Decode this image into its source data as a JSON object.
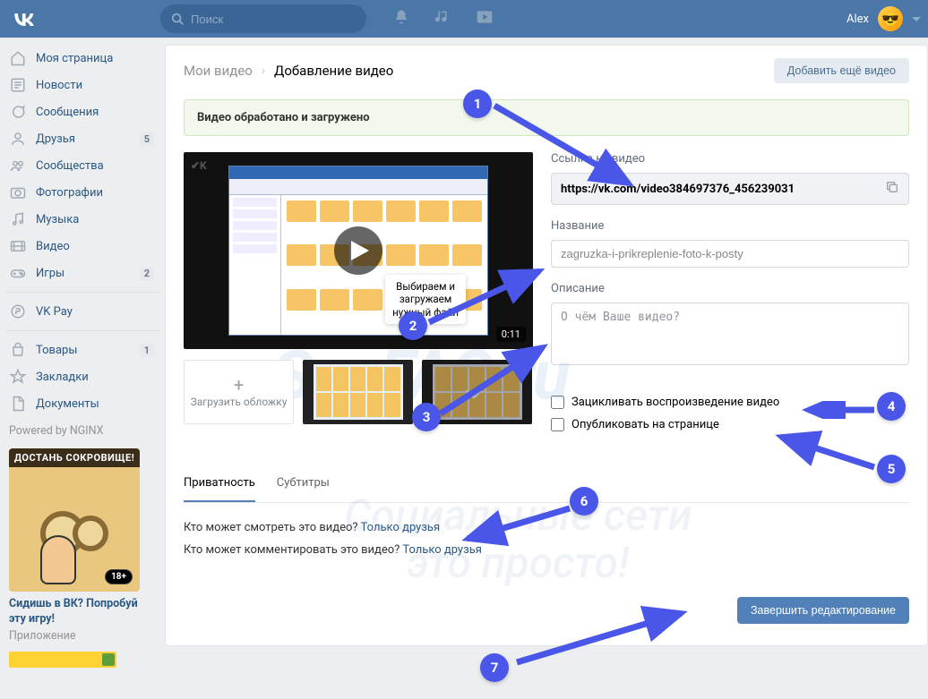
{
  "header": {
    "search_placeholder": "Поиск",
    "user_name": "Alex"
  },
  "sidebar": {
    "items": [
      {
        "label": "Моя страница"
      },
      {
        "label": "Новости"
      },
      {
        "label": "Сообщения"
      },
      {
        "label": "Друзья",
        "badge": "5"
      },
      {
        "label": "Сообщества"
      },
      {
        "label": "Фотографии"
      },
      {
        "label": "Музыка"
      },
      {
        "label": "Видео"
      },
      {
        "label": "Игры",
        "badge": "2"
      },
      {
        "label": "VK Pay"
      },
      {
        "label": "Товары",
        "badge": "1"
      },
      {
        "label": "Закладки"
      },
      {
        "label": "Документы"
      }
    ],
    "powered": "Powered by NGINX",
    "promo": {
      "banner": "ДОСТАНЬ СОКРОВИЩЕ!",
      "age": "18+",
      "title": "Сидишь в ВК? Попробуй эту игру!",
      "sub": "Приложение"
    }
  },
  "breadcrumb": {
    "parent": "Мои видео",
    "current": "Добавление видео"
  },
  "add_button": "Добавить ещё видео",
  "alert": "Видео обработано и загружено",
  "video": {
    "duration": "0:11",
    "tooltip_l1": "Выбираем и",
    "tooltip_l2": "загружаем",
    "tooltip_l3": "нужный файл",
    "upload_cover": "Загрузить обложку"
  },
  "form": {
    "link_label": "Ссылка на видео",
    "link_value": "https://vk.com/video384697376_456239031",
    "title_label": "Название",
    "title_value": "zagruzka-i-prikreplenie-foto-k-posty",
    "desc_label": "Описание",
    "desc_placeholder": "О чём Ваше видео?",
    "check_loop": "Зацикливать воспроизведение видео",
    "check_publish": "Опубликовать на странице"
  },
  "tabs": {
    "privacy": "Приватность",
    "subs": "Субтитры"
  },
  "privacy": {
    "q_view": "Кто может смотреть это видео?",
    "q_comment": "Кто может комментировать это видео?",
    "link": "Только друзья"
  },
  "finish_button": "Завершить редактирование",
  "watermark": {
    "l1": "SocFAQ.ru",
    "l2": "Социальные сети",
    "l3": "это просто!"
  }
}
